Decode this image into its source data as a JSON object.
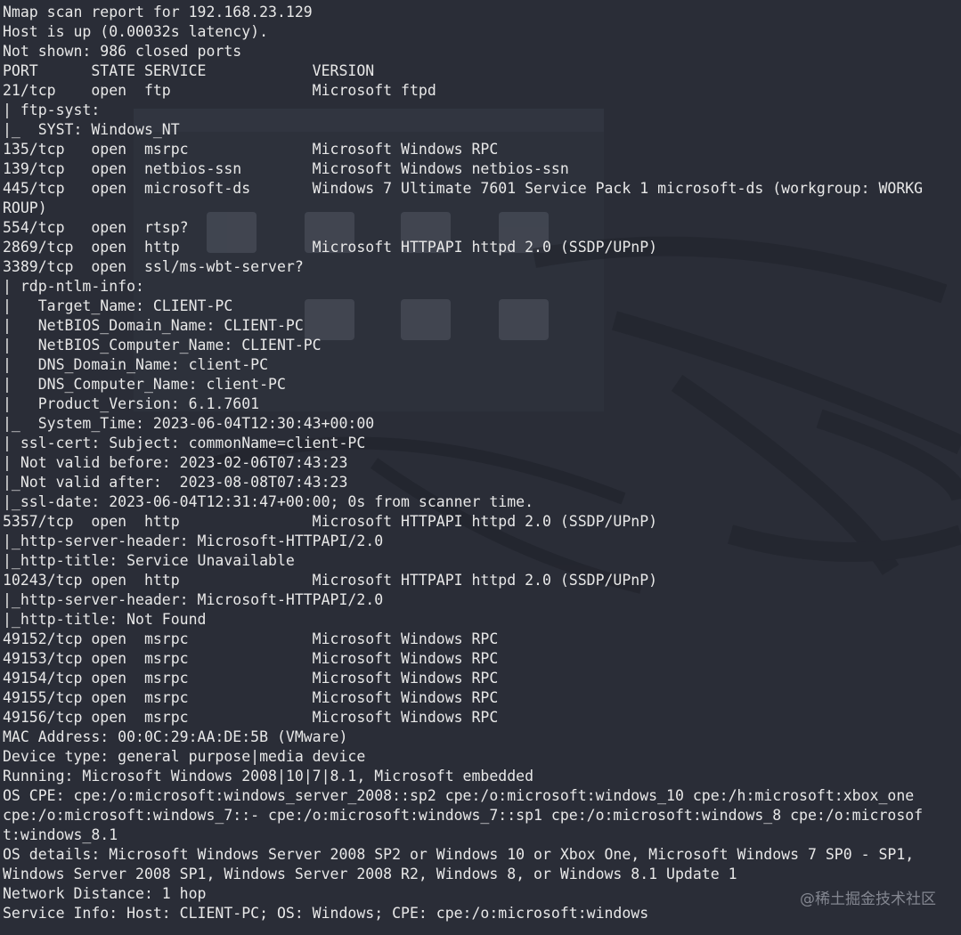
{
  "terminal": {
    "lines": [
      "Nmap scan report for 192.168.23.129",
      "Host is up (0.00032s latency).",
      "Not shown: 986 closed ports",
      "PORT      STATE SERVICE            VERSION",
      "21/tcp    open  ftp                Microsoft ftpd",
      "| ftp-syst:",
      "|_  SYST: Windows_NT",
      "135/tcp   open  msrpc              Microsoft Windows RPC",
      "139/tcp   open  netbios-ssn        Microsoft Windows netbios-ssn",
      "445/tcp   open  microsoft-ds       Windows 7 Ultimate 7601 Service Pack 1 microsoft-ds (workgroup: WORKG",
      "ROUP)",
      "554/tcp   open  rtsp?",
      "2869/tcp  open  http               Microsoft HTTPAPI httpd 2.0 (SSDP/UPnP)",
      "3389/tcp  open  ssl/ms-wbt-server?",
      "| rdp-ntlm-info:",
      "|   Target_Name: CLIENT-PC",
      "|   NetBIOS_Domain_Name: CLIENT-PC",
      "|   NetBIOS_Computer_Name: CLIENT-PC",
      "|   DNS_Domain_Name: client-PC",
      "|   DNS_Computer_Name: client-PC",
      "|   Product_Version: 6.1.7601",
      "|_  System_Time: 2023-06-04T12:30:43+00:00",
      "| ssl-cert: Subject: commonName=client-PC",
      "| Not valid before: 2023-02-06T07:43:23",
      "|_Not valid after:  2023-08-08T07:43:23",
      "|_ssl-date: 2023-06-04T12:31:47+00:00; 0s from scanner time.",
      "5357/tcp  open  http               Microsoft HTTPAPI httpd 2.0 (SSDP/UPnP)",
      "|_http-server-header: Microsoft-HTTPAPI/2.0",
      "|_http-title: Service Unavailable",
      "10243/tcp open  http               Microsoft HTTPAPI httpd 2.0 (SSDP/UPnP)",
      "|_http-server-header: Microsoft-HTTPAPI/2.0",
      "|_http-title: Not Found",
      "49152/tcp open  msrpc              Microsoft Windows RPC",
      "49153/tcp open  msrpc              Microsoft Windows RPC",
      "49154/tcp open  msrpc              Microsoft Windows RPC",
      "49155/tcp open  msrpc              Microsoft Windows RPC",
      "49156/tcp open  msrpc              Microsoft Windows RPC",
      "MAC Address: 00:0C:29:AA:DE:5B (VMware)",
      "Device type: general purpose|media device",
      "Running: Microsoft Windows 2008|10|7|8.1, Microsoft embedded",
      "OS CPE: cpe:/o:microsoft:windows_server_2008::sp2 cpe:/o:microsoft:windows_10 cpe:/h:microsoft:xbox_one",
      "cpe:/o:microsoft:windows_7::- cpe:/o:microsoft:windows_7::sp1 cpe:/o:microsoft:windows_8 cpe:/o:microsof",
      "t:windows_8.1",
      "OS details: Microsoft Windows Server 2008 SP2 or Windows 10 or Xbox One, Microsoft Windows 7 SP0 - SP1,",
      "Windows Server 2008 SP1, Windows Server 2008 R2, Windows 8, or Windows 8.1 Update 1",
      "Network Distance: 1 hop",
      "Service Info: Host: CLIENT-PC; OS: Windows; CPE: cpe:/o:microsoft:windows"
    ]
  },
  "watermark": {
    "text": "@稀土掘金技术社区"
  },
  "colors": {
    "background": "#2a2d37",
    "text": "#e8e8e8",
    "watermark": "#b4b7c0"
  }
}
